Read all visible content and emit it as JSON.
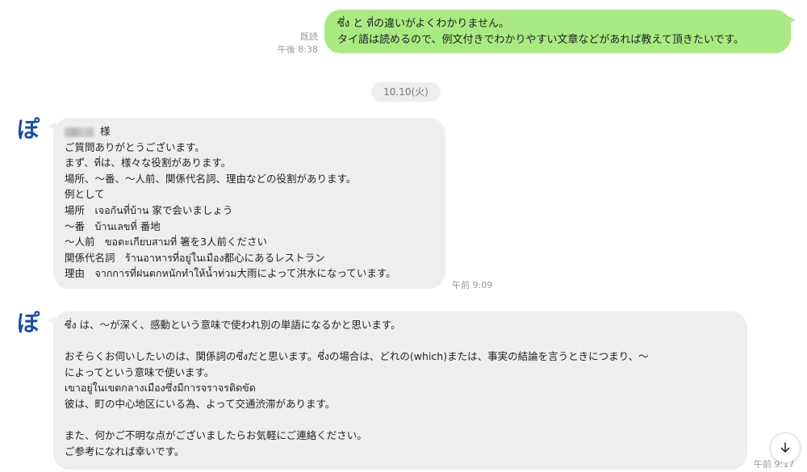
{
  "outgoing": {
    "lines": [
      "ซึ่ง と ที่の違いがよくわかりません。",
      "タイ語は読めるので、例文付きでわかりやすい文章などがあれば教えて頂きたいです。"
    ],
    "read_label": "既読",
    "time": "午後 8:38"
  },
  "date_divider": "10.10(火)",
  "avatar_glyph": "ぽ",
  "message1": {
    "name_suffix": "様",
    "lines": [
      "ご質問ありがとうございます。",
      "まず、ที่は、様々な役割があります。",
      "場所、〜番、〜人前、関係代名詞、理由などの役割があります。",
      "例として",
      "場所　เจอกันที่บ้าน 家で会いましょう",
      "〜番　บ้านเลขที่ 番地",
      "〜人前　ขอตะเกียบสามที่ 箸を3人前ください",
      "関係代名詞　ร้านอาหารที่อยู่ในเมือง都心にあるレストラン",
      "理由　จากการที่ฝนตกหนักทำให้น้ำท่วม大雨によって洪水になっています。"
    ],
    "time": "午前 9:09"
  },
  "message2": {
    "lines": [
      "ซึ่ง は、〜が深く、感動という意味で使われ別の単語になるかと思います。",
      "",
      "おそらくお伺いしたいのは、関係詞のซึ่งだと思います。ซึ่งの場合は、どれの(which)または、事実の結論を言うときにつまり、〜",
      "によってという意味で使います。",
      "เขาอยู่ในเขตกลางเมืองซึ่งมีการจราจรติดขัด",
      "彼は、町の中心地区にいる為、よって交通渋滞があります。",
      "",
      "また、何かご不明な点がございましたらお気軽にご連絡ください。",
      "ご参考になれば幸いです。"
    ],
    "time": "午前 9:17"
  },
  "icons": {
    "avatar": "po-hiragana-logo",
    "scroll_down": "arrow-down-icon"
  },
  "colors": {
    "outgoing_bubble": "#a9ea83",
    "incoming_bubble": "#eeeeee",
    "avatar": "#1a4fa0"
  }
}
